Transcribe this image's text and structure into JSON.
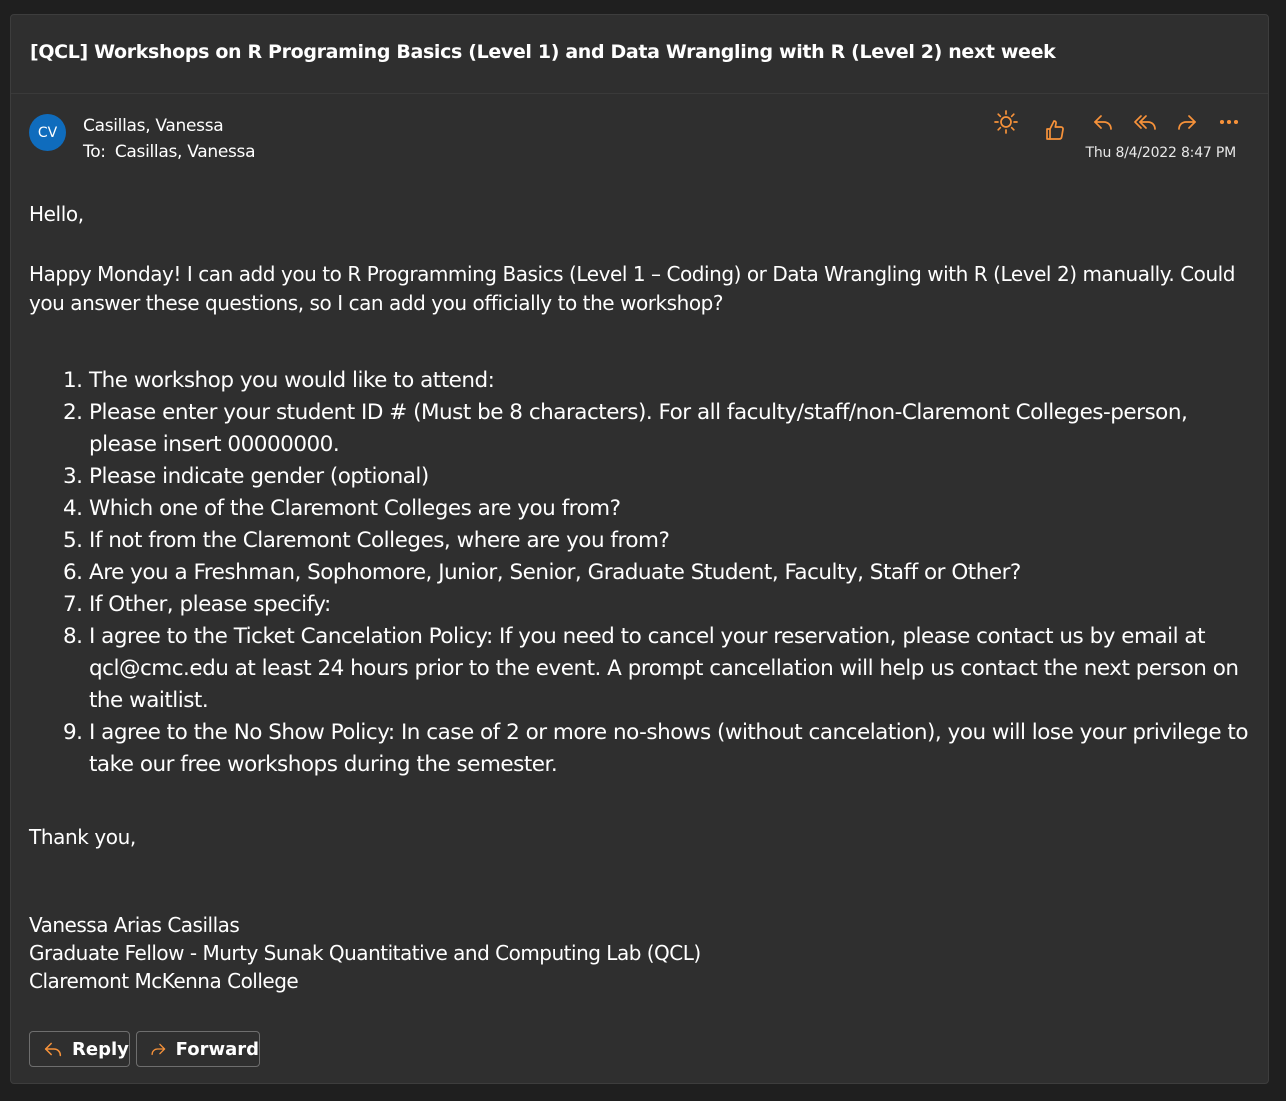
{
  "email": {
    "subject": "[QCL] Workshops on R Programing Basics (Level 1) and Data Wrangling with R (Level 2) next week",
    "avatar_initials": "CV",
    "sender_name": "Casillas, Vanessa",
    "to_label": "To:",
    "recipient": "Casillas, Vanessa",
    "timestamp": "Thu 8/4/2022 8:47 PM",
    "accent_color": "#f7923a",
    "avatar_color": "#0f6cbd"
  },
  "actions": {
    "immersive_reader": "sun-icon",
    "like": "thumbs-up-icon",
    "reply": "reply-icon",
    "reply_all": "reply-all-icon",
    "forward": "forward-icon",
    "more": "more-icon"
  },
  "body": {
    "greeting": "Hello,",
    "intro": "Happy Monday! I can add you to R Programming Basics (Level 1 – Coding) or Data Wrangling with R (Level 2) manually. Could you answer these questions, so I can add you officially to the workshop?",
    "questions": [
      {
        "num": "1.",
        "text": "The workshop you would like to attend:"
      },
      {
        "num": "2.",
        "text": "Please enter your student ID # (Must be 8 characters). For all faculty/staff/non-Claremont Colleges-person, please insert 00000000."
      },
      {
        "num": "3.",
        "text": "Please indicate gender (optional)"
      },
      {
        "num": "4.",
        "text": "Which one of the Claremont Colleges are you from?"
      },
      {
        "num": "5.",
        "text": "If not from the Claremont Colleges, where are you from?"
      },
      {
        "num": "6.",
        "text": "Are you a Freshman, Sophomore, Junior, Senior, Graduate Student, Faculty, Staff or Other?"
      },
      {
        "num": "7.",
        "text": "If Other, please specify:"
      },
      {
        "num": "8.",
        "text": "I agree to the Ticket Cancelation Policy: If you need to cancel your reservation, please contact us by email at qcl@cmc.edu at least 24 hours prior to the event. A prompt cancellation will help us contact the next person on the waitlist."
      },
      {
        "num": "9.",
        "text": "I agree to the No Show Policy: In case of 2 or more no-shows (without cancelation), you will lose your privilege to take our free workshops during the semester."
      }
    ],
    "closing": "Thank you,",
    "signature": {
      "name": "Vanessa Arias Casillas",
      "title": "Graduate Fellow - Murty Sunak Quantitative and Computing Lab (QCL)",
      "org": "Claremont McKenna College"
    }
  },
  "footer": {
    "reply_label": "Reply",
    "forward_label": "Forward"
  }
}
